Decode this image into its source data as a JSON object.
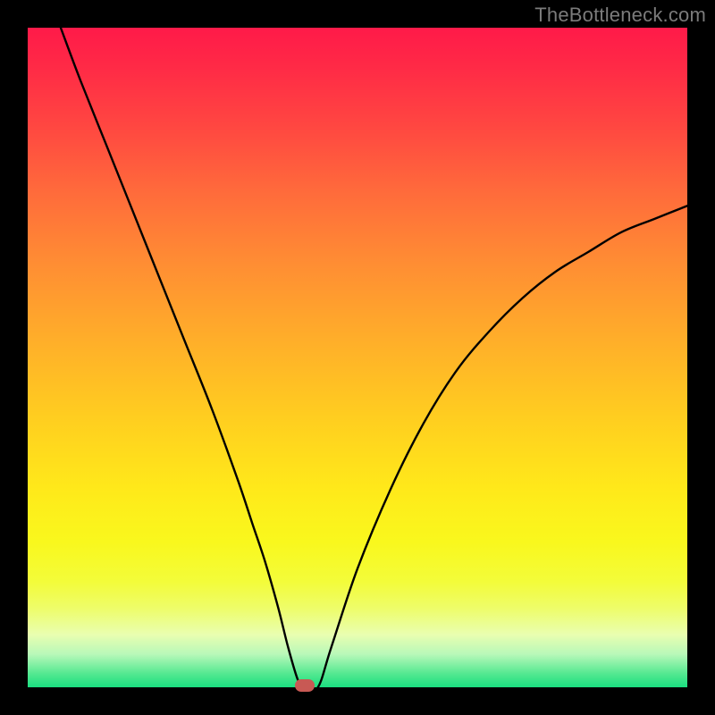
{
  "watermark": "TheBottleneck.com",
  "chart_data": {
    "type": "line",
    "title": "",
    "xlabel": "",
    "ylabel": "",
    "xlim": [
      0,
      100
    ],
    "ylim": [
      0,
      100
    ],
    "series": [
      {
        "name": "bottleneck-curve",
        "x": [
          5,
          8,
          12,
          16,
          20,
          24,
          28,
          32,
          34,
          36,
          38,
          39.5,
          41,
          42,
          44,
          46,
          50,
          55,
          60,
          65,
          70,
          75,
          80,
          85,
          90,
          95,
          100
        ],
        "y": [
          100,
          92,
          82,
          72,
          62,
          52,
          42,
          31,
          25,
          19,
          12,
          6,
          1,
          0,
          0,
          6,
          18,
          30,
          40,
          48,
          54,
          59,
          63,
          66,
          69,
          71,
          73
        ]
      }
    ],
    "marker": {
      "x": 42,
      "y": 0
    },
    "gradient_stops": [
      {
        "pos": 0.0,
        "color": "#ff1a49"
      },
      {
        "pos": 0.5,
        "color": "#ffc024"
      },
      {
        "pos": 0.8,
        "color": "#f7fb2c"
      },
      {
        "pos": 1.0,
        "color": "#1ade80"
      }
    ]
  }
}
